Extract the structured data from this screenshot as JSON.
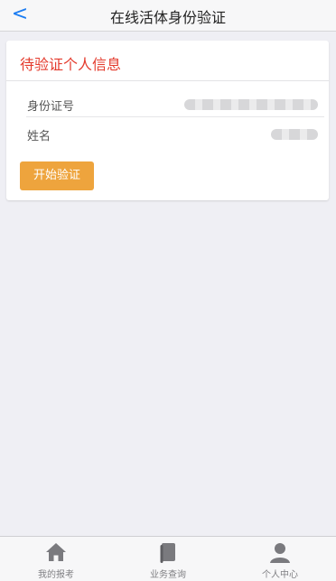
{
  "header": {
    "title": "在线活体身份验证",
    "back_symbol": "<"
  },
  "card": {
    "title": "待验证个人信息",
    "fields": [
      {
        "label": "身份证号",
        "value": ""
      },
      {
        "label": "姓名",
        "value": ""
      }
    ],
    "start_button": "开始验证"
  },
  "tabbar": {
    "items": [
      {
        "label": "我的报考",
        "icon": "home-icon"
      },
      {
        "label": "业务查询",
        "icon": "book-icon"
      },
      {
        "label": "个人中心",
        "icon": "person-icon"
      }
    ]
  },
  "colors": {
    "accent": "#e43b2d",
    "button": "#eea43d",
    "back": "#1a7cf2"
  }
}
